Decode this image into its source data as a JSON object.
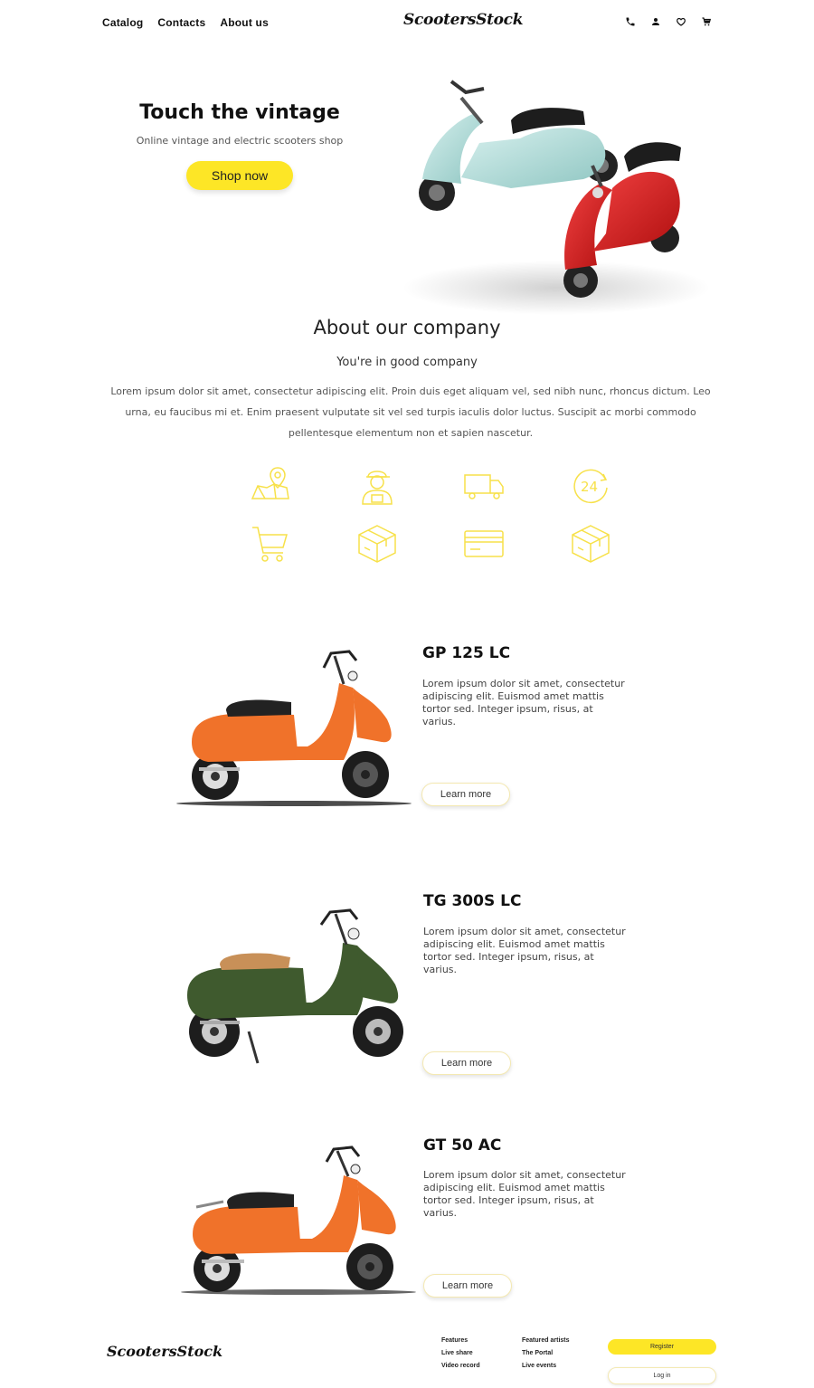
{
  "header": {
    "nav": [
      "Catalog",
      "Contacts",
      "About us"
    ],
    "logo": "ScootersStock",
    "icons": [
      "phone-icon",
      "user-icon",
      "heart-icon",
      "cart-icon"
    ]
  },
  "hero": {
    "title": "Touch the vintage",
    "subtitle": "Online vintage and electric scooters shop",
    "cta": "Shop now"
  },
  "about": {
    "title": "About our company",
    "subtitle": "You're in good company",
    "text": "Lorem ipsum dolor sit amet, consectetur adipiscing elit. Proin duis eget aliquam vel, sed nibh nunc, rhoncus dictum. Leo urna, eu faucibus mi et. Enim praesent vulputate sit vel sed turpis iaculis dolor luctus. Suscipit ac morbi commodo pellentesque elementum non et sapien nascetur."
  },
  "features": {
    "icons": [
      "map-pin-icon",
      "courier-icon",
      "truck-icon",
      "clock-24-icon",
      "cart-icon",
      "box-icon",
      "credit-card-icon",
      "box-icon"
    ],
    "clock_label": "24"
  },
  "products": [
    {
      "name": "GP 125 LC",
      "description": "Lorem ipsum dolor sit amet, consectetur adipiscing elit. Euismod amet mattis tortor sed. Integer ipsum, risus, at varius.",
      "button": "Learn more",
      "color": "#f0722a"
    },
    {
      "name": "TG 300S LC",
      "description": "Lorem ipsum dolor sit amet, consectetur adipiscing elit. Euismod amet mattis tortor sed. Integer ipsum, risus, at varius.",
      "button": "Learn more",
      "color": "#3f5a2e"
    },
    {
      "name": "GT 50 AC",
      "description": "Lorem ipsum dolor sit amet, consectetur adipiscing elit. Euismod amet mattis tortor sed. Integer ipsum, risus, at varius.",
      "button": "Learn more",
      "color": "#f0722a"
    }
  ],
  "footer": {
    "logo": "ScootersStock",
    "col1": [
      "Features",
      "Live share",
      "Video record"
    ],
    "col2": [
      "Featured artists",
      "The Portal",
      "Live events"
    ],
    "register": "Register",
    "login": "Log in"
  },
  "colors": {
    "accent": "#fde626",
    "icon_line": "#f7e14a",
    "hero_scooter_mint": "#a9d9d6",
    "hero_scooter_red": "#d81f1f"
  }
}
